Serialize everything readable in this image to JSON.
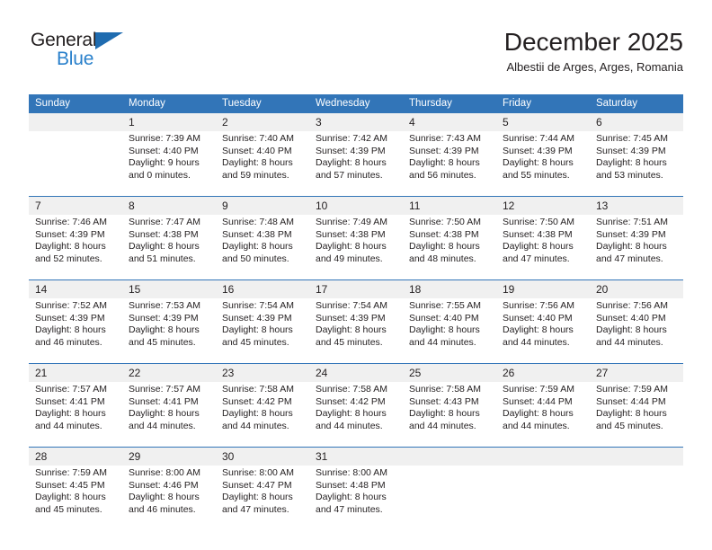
{
  "brand": {
    "name_part1": "General",
    "name_part2": "Blue",
    "triangle_color": "#1f6cb0",
    "blue_color": "#2980cb"
  },
  "header": {
    "month_title": "December 2025",
    "location": "Albestii de Arges, Arges, Romania",
    "header_bg_color": "#3275b8",
    "header_text_color": "#ffffff"
  },
  "weekday_headers": [
    "Sunday",
    "Monday",
    "Tuesday",
    "Wednesday",
    "Thursday",
    "Friday",
    "Saturday"
  ],
  "weeks": [
    {
      "days": [
        {
          "num": "",
          "sunrise": "",
          "sunset": "",
          "daylight1": "",
          "daylight2": ""
        },
        {
          "num": "1",
          "sunrise": "Sunrise: 7:39 AM",
          "sunset": "Sunset: 4:40 PM",
          "daylight1": "Daylight: 9 hours",
          "daylight2": "and 0 minutes."
        },
        {
          "num": "2",
          "sunrise": "Sunrise: 7:40 AM",
          "sunset": "Sunset: 4:40 PM",
          "daylight1": "Daylight: 8 hours",
          "daylight2": "and 59 minutes."
        },
        {
          "num": "3",
          "sunrise": "Sunrise: 7:42 AM",
          "sunset": "Sunset: 4:39 PM",
          "daylight1": "Daylight: 8 hours",
          "daylight2": "and 57 minutes."
        },
        {
          "num": "4",
          "sunrise": "Sunrise: 7:43 AM",
          "sunset": "Sunset: 4:39 PM",
          "daylight1": "Daylight: 8 hours",
          "daylight2": "and 56 minutes."
        },
        {
          "num": "5",
          "sunrise": "Sunrise: 7:44 AM",
          "sunset": "Sunset: 4:39 PM",
          "daylight1": "Daylight: 8 hours",
          "daylight2": "and 55 minutes."
        },
        {
          "num": "6",
          "sunrise": "Sunrise: 7:45 AM",
          "sunset": "Sunset: 4:39 PM",
          "daylight1": "Daylight: 8 hours",
          "daylight2": "and 53 minutes."
        }
      ]
    },
    {
      "days": [
        {
          "num": "7",
          "sunrise": "Sunrise: 7:46 AM",
          "sunset": "Sunset: 4:39 PM",
          "daylight1": "Daylight: 8 hours",
          "daylight2": "and 52 minutes."
        },
        {
          "num": "8",
          "sunrise": "Sunrise: 7:47 AM",
          "sunset": "Sunset: 4:38 PM",
          "daylight1": "Daylight: 8 hours",
          "daylight2": "and 51 minutes."
        },
        {
          "num": "9",
          "sunrise": "Sunrise: 7:48 AM",
          "sunset": "Sunset: 4:38 PM",
          "daylight1": "Daylight: 8 hours",
          "daylight2": "and 50 minutes."
        },
        {
          "num": "10",
          "sunrise": "Sunrise: 7:49 AM",
          "sunset": "Sunset: 4:38 PM",
          "daylight1": "Daylight: 8 hours",
          "daylight2": "and 49 minutes."
        },
        {
          "num": "11",
          "sunrise": "Sunrise: 7:50 AM",
          "sunset": "Sunset: 4:38 PM",
          "daylight1": "Daylight: 8 hours",
          "daylight2": "and 48 minutes."
        },
        {
          "num": "12",
          "sunrise": "Sunrise: 7:50 AM",
          "sunset": "Sunset: 4:38 PM",
          "daylight1": "Daylight: 8 hours",
          "daylight2": "and 47 minutes."
        },
        {
          "num": "13",
          "sunrise": "Sunrise: 7:51 AM",
          "sunset": "Sunset: 4:39 PM",
          "daylight1": "Daylight: 8 hours",
          "daylight2": "and 47 minutes."
        }
      ]
    },
    {
      "days": [
        {
          "num": "14",
          "sunrise": "Sunrise: 7:52 AM",
          "sunset": "Sunset: 4:39 PM",
          "daylight1": "Daylight: 8 hours",
          "daylight2": "and 46 minutes."
        },
        {
          "num": "15",
          "sunrise": "Sunrise: 7:53 AM",
          "sunset": "Sunset: 4:39 PM",
          "daylight1": "Daylight: 8 hours",
          "daylight2": "and 45 minutes."
        },
        {
          "num": "16",
          "sunrise": "Sunrise: 7:54 AM",
          "sunset": "Sunset: 4:39 PM",
          "daylight1": "Daylight: 8 hours",
          "daylight2": "and 45 minutes."
        },
        {
          "num": "17",
          "sunrise": "Sunrise: 7:54 AM",
          "sunset": "Sunset: 4:39 PM",
          "daylight1": "Daylight: 8 hours",
          "daylight2": "and 45 minutes."
        },
        {
          "num": "18",
          "sunrise": "Sunrise: 7:55 AM",
          "sunset": "Sunset: 4:40 PM",
          "daylight1": "Daylight: 8 hours",
          "daylight2": "and 44 minutes."
        },
        {
          "num": "19",
          "sunrise": "Sunrise: 7:56 AM",
          "sunset": "Sunset: 4:40 PM",
          "daylight1": "Daylight: 8 hours",
          "daylight2": "and 44 minutes."
        },
        {
          "num": "20",
          "sunrise": "Sunrise: 7:56 AM",
          "sunset": "Sunset: 4:40 PM",
          "daylight1": "Daylight: 8 hours",
          "daylight2": "and 44 minutes."
        }
      ]
    },
    {
      "days": [
        {
          "num": "21",
          "sunrise": "Sunrise: 7:57 AM",
          "sunset": "Sunset: 4:41 PM",
          "daylight1": "Daylight: 8 hours",
          "daylight2": "and 44 minutes."
        },
        {
          "num": "22",
          "sunrise": "Sunrise: 7:57 AM",
          "sunset": "Sunset: 4:41 PM",
          "daylight1": "Daylight: 8 hours",
          "daylight2": "and 44 minutes."
        },
        {
          "num": "23",
          "sunrise": "Sunrise: 7:58 AM",
          "sunset": "Sunset: 4:42 PM",
          "daylight1": "Daylight: 8 hours",
          "daylight2": "and 44 minutes."
        },
        {
          "num": "24",
          "sunrise": "Sunrise: 7:58 AM",
          "sunset": "Sunset: 4:42 PM",
          "daylight1": "Daylight: 8 hours",
          "daylight2": "and 44 minutes."
        },
        {
          "num": "25",
          "sunrise": "Sunrise: 7:58 AM",
          "sunset": "Sunset: 4:43 PM",
          "daylight1": "Daylight: 8 hours",
          "daylight2": "and 44 minutes."
        },
        {
          "num": "26",
          "sunrise": "Sunrise: 7:59 AM",
          "sunset": "Sunset: 4:44 PM",
          "daylight1": "Daylight: 8 hours",
          "daylight2": "and 44 minutes."
        },
        {
          "num": "27",
          "sunrise": "Sunrise: 7:59 AM",
          "sunset": "Sunset: 4:44 PM",
          "daylight1": "Daylight: 8 hours",
          "daylight2": "and 45 minutes."
        }
      ]
    },
    {
      "days": [
        {
          "num": "28",
          "sunrise": "Sunrise: 7:59 AM",
          "sunset": "Sunset: 4:45 PM",
          "daylight1": "Daylight: 8 hours",
          "daylight2": "and 45 minutes."
        },
        {
          "num": "29",
          "sunrise": "Sunrise: 8:00 AM",
          "sunset": "Sunset: 4:46 PM",
          "daylight1": "Daylight: 8 hours",
          "daylight2": "and 46 minutes."
        },
        {
          "num": "30",
          "sunrise": "Sunrise: 8:00 AM",
          "sunset": "Sunset: 4:47 PM",
          "daylight1": "Daylight: 8 hours",
          "daylight2": "and 47 minutes."
        },
        {
          "num": "31",
          "sunrise": "Sunrise: 8:00 AM",
          "sunset": "Sunset: 4:48 PM",
          "daylight1": "Daylight: 8 hours",
          "daylight2": "and 47 minutes."
        },
        {
          "num": "",
          "sunrise": "",
          "sunset": "",
          "daylight1": "",
          "daylight2": ""
        },
        {
          "num": "",
          "sunrise": "",
          "sunset": "",
          "daylight1": "",
          "daylight2": ""
        },
        {
          "num": "",
          "sunrise": "",
          "sunset": "",
          "daylight1": "",
          "daylight2": ""
        }
      ]
    }
  ]
}
